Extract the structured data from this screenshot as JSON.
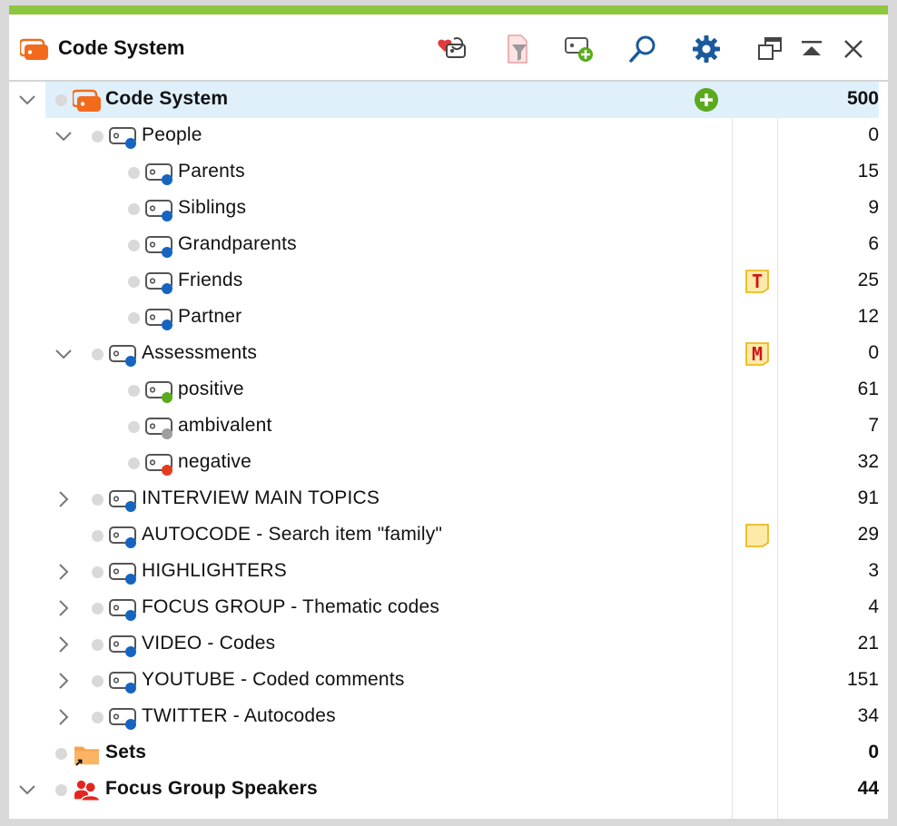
{
  "window": {
    "title": "Code System",
    "accent_color": "#8dc63f"
  },
  "toolbar": {
    "buttons": [
      {
        "name": "reset-activation-icon"
      },
      {
        "name": "filter-icon"
      },
      {
        "name": "new-code-icon"
      },
      {
        "name": "search-icon"
      },
      {
        "name": "gear-icon"
      },
      {
        "name": "undock-icon"
      },
      {
        "name": "collapse-up-icon"
      },
      {
        "name": "close-icon"
      }
    ]
  },
  "tree": {
    "root": {
      "label": "Code System",
      "count": "500"
    },
    "items": [
      {
        "label": "People",
        "count": "0",
        "color": "#1565c0",
        "memo": ""
      },
      {
        "label": "Parents",
        "count": "15",
        "color": "#1565c0",
        "memo": ""
      },
      {
        "label": "Siblings",
        "count": "9",
        "color": "#1565c0",
        "memo": ""
      },
      {
        "label": "Grandparents",
        "count": "6",
        "color": "#1565c0",
        "memo": ""
      },
      {
        "label": "Friends",
        "count": "25",
        "color": "#1565c0",
        "memo": "T"
      },
      {
        "label": "Partner",
        "count": "12",
        "color": "#1565c0",
        "memo": ""
      },
      {
        "label": "Assessments",
        "count": "0",
        "color": "#1565c0",
        "memo": "M"
      },
      {
        "label": "positive",
        "count": "61",
        "color": "#5aaa1e",
        "memo": ""
      },
      {
        "label": "ambivalent",
        "count": "7",
        "color": "#9e9e9e",
        "memo": ""
      },
      {
        "label": "negative",
        "count": "32",
        "color": "#e53a1e",
        "memo": ""
      },
      {
        "label": "INTERVIEW MAIN TOPICS",
        "count": "91",
        "color": "#1565c0",
        "memo": ""
      },
      {
        "label": "AUTOCODE - Search item \"family\"",
        "count": "29",
        "color": "#1565c0",
        "memo": "blank"
      },
      {
        "label": "HIGHLIGHTERS",
        "count": "3",
        "color": "#1565c0",
        "memo": ""
      },
      {
        "label": "FOCUS GROUP - Thematic codes",
        "count": "4",
        "color": "#1565c0",
        "memo": ""
      },
      {
        "label": "VIDEO - Codes",
        "count": "21",
        "color": "#1565c0",
        "memo": ""
      },
      {
        "label": "YOUTUBE - Coded comments",
        "count": "151",
        "color": "#1565c0",
        "memo": ""
      },
      {
        "label": "TWITTER - Autocodes",
        "count": "34",
        "color": "#1565c0",
        "memo": ""
      }
    ],
    "sets": {
      "label": "Sets",
      "count": "0"
    },
    "speakers": {
      "label": "Focus Group Speakers",
      "count": "44"
    },
    "memo_letters": {
      "t": "T",
      "m": "M"
    }
  }
}
